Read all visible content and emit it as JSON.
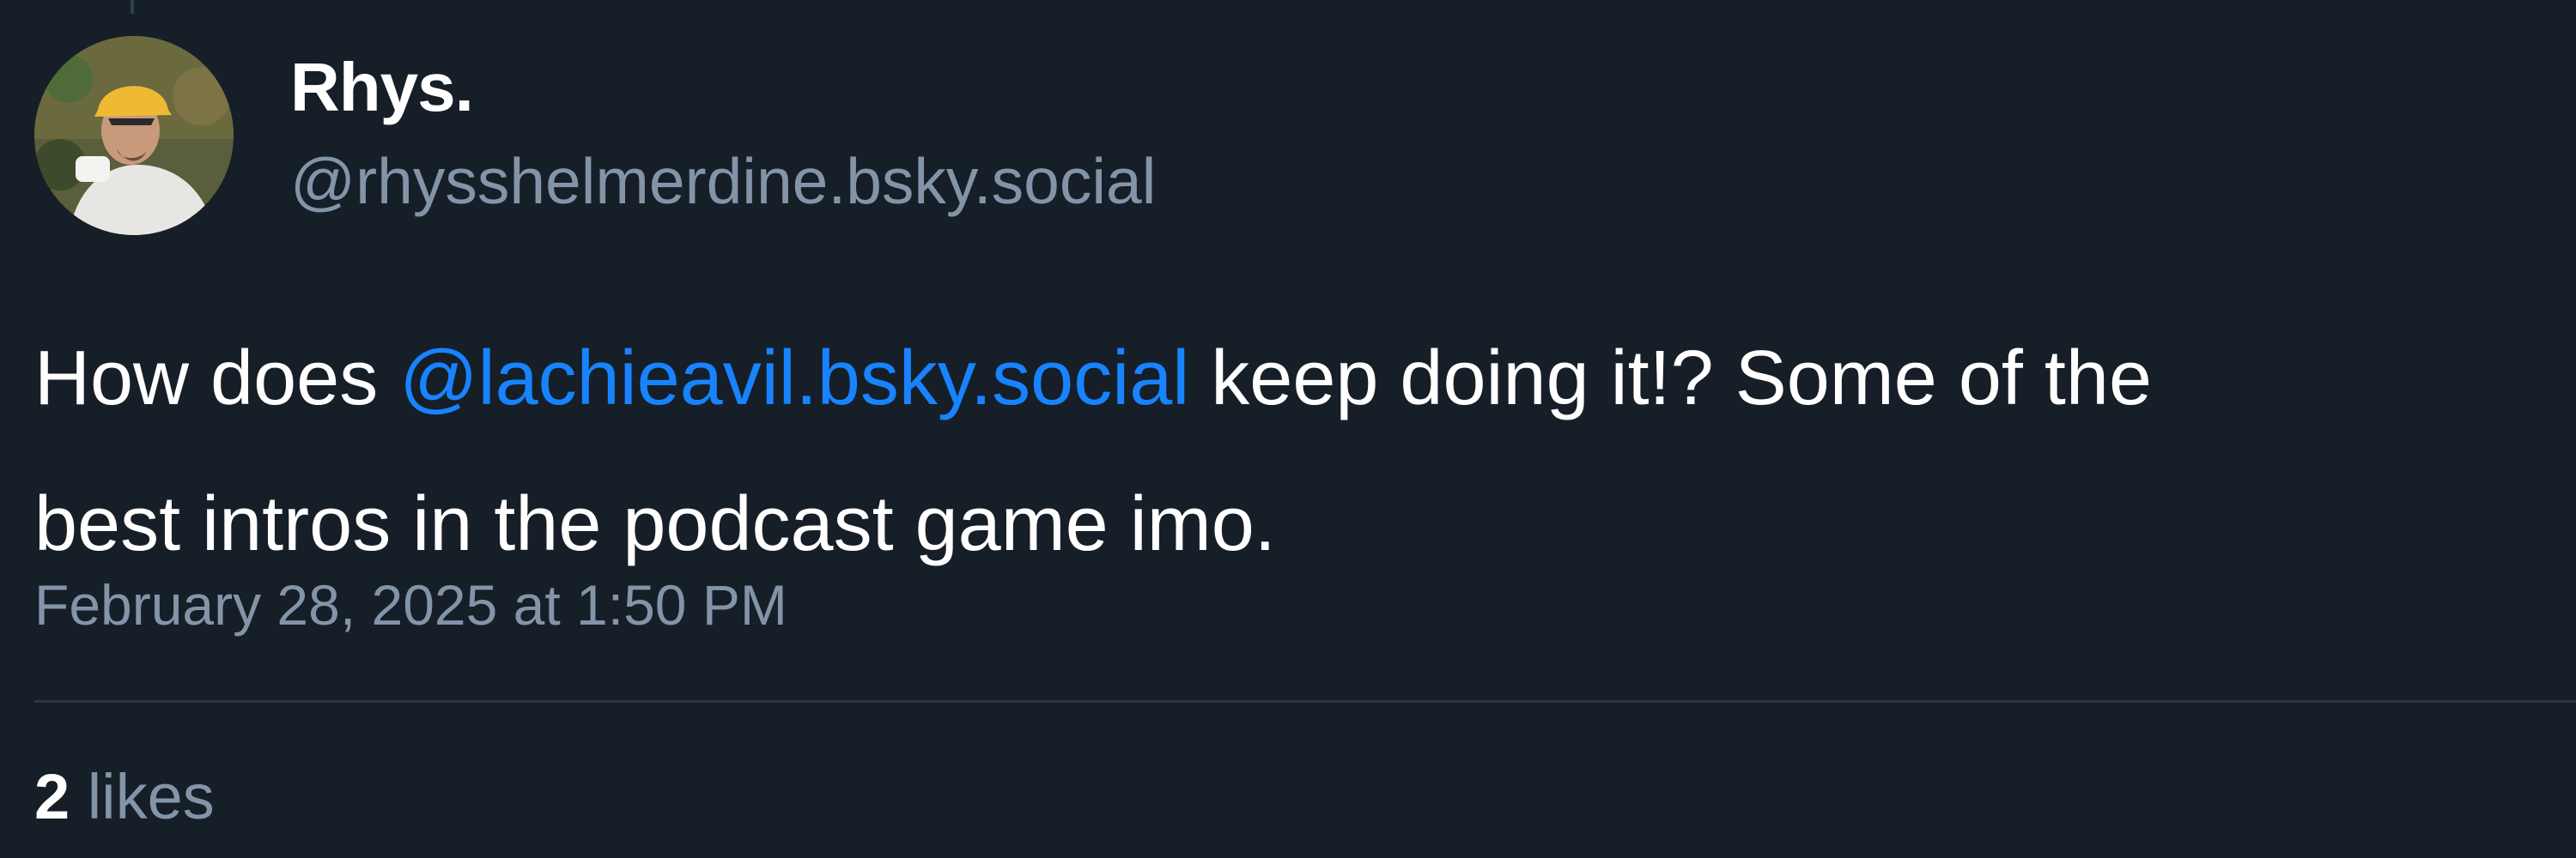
{
  "post": {
    "author": {
      "display_name": "Rhys.",
      "handle": "@rhysshelmerdine.bsky.social"
    },
    "text": {
      "before_mention": "How does ",
      "mention": "@lachieavil.bsky.social",
      "after_mention_line1": " keep doing it!? Some of the",
      "line2": "best intros in the podcast game imo."
    },
    "timestamp": "February 28, 2025 at 1:50 PM",
    "likes": {
      "count": "2",
      "label": " likes"
    }
  },
  "colors": {
    "background": "#161e27",
    "mention": "#1883fe",
    "secondary_text": "#8494a8",
    "primary_text": "#ffffff"
  },
  "icons": {
    "avatar": "user-avatar-photo"
  }
}
